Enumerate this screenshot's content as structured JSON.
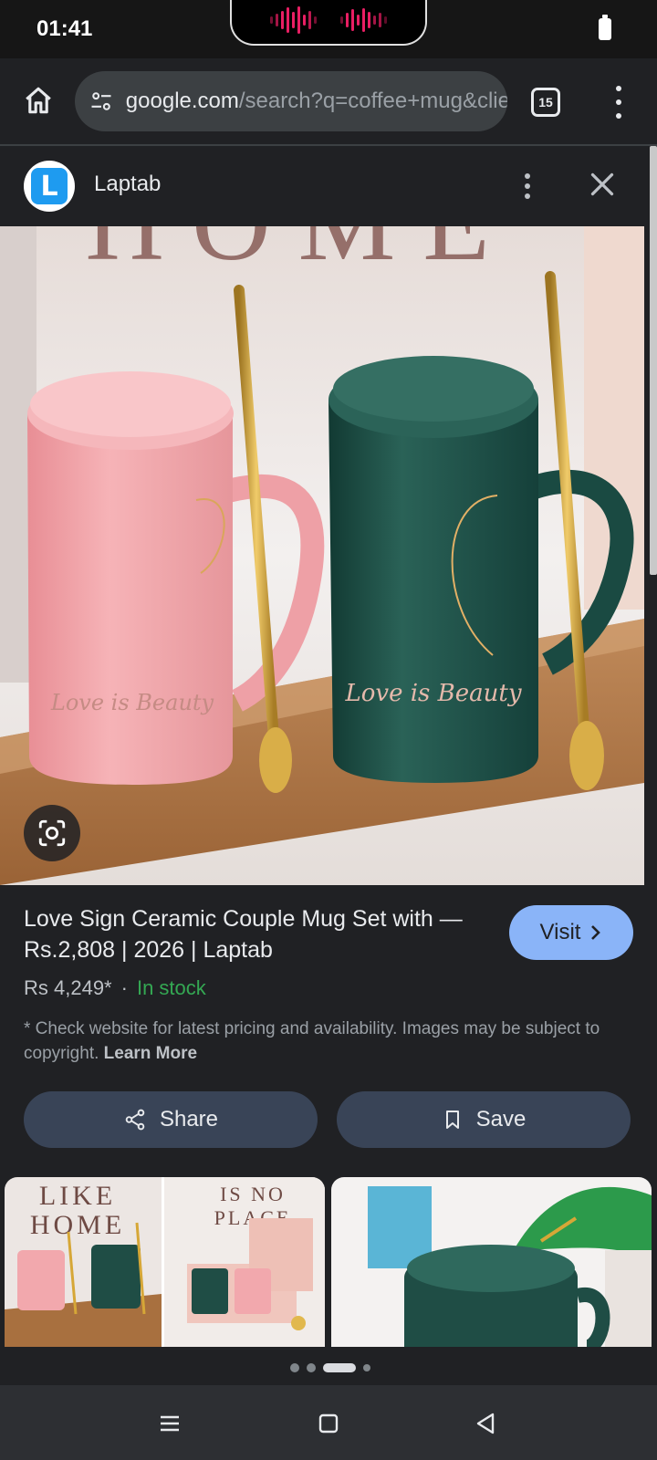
{
  "status_bar": {
    "time": "01:41"
  },
  "browser": {
    "url_host": "google.com",
    "url_path": "/search?q=coffee+mug&clie",
    "tab_count": "15"
  },
  "source": {
    "logo_letter": "L",
    "name": "Laptab"
  },
  "product": {
    "title": "Love Sign Ceramic Couple Mug Set with — Rs.2,808 | 2026 | Laptab",
    "price": "Rs 4,249*",
    "separator": "·",
    "stock": "In stock",
    "disclaimer": "* Check website for latest pricing and availability. Images may be subject to copyright.",
    "learn_more": "Learn More"
  },
  "image_text": {
    "wall_text": "HOME",
    "mug_text": "Love is Beauty",
    "thumb_wall_1": "LIKE",
    "thumb_wall_2": "HOME",
    "thumb_wall_3": "IS NO",
    "thumb_wall_4": "PLACE"
  },
  "actions": {
    "visit": "Visit",
    "share": "Share",
    "save": "Save"
  },
  "colors": {
    "accent": "#8ab4f8",
    "stock_green": "#34a853",
    "pink_mug": "#f2a3a8",
    "green_mug": "#1d4a42",
    "gold": "#d6a737"
  },
  "carousel": {
    "pages": 4,
    "active_index": 2
  },
  "icons": {
    "home": "home-icon",
    "site_settings": "tune-icon",
    "menu": "more-vert-icon",
    "close": "close-icon",
    "lens": "google-lens-icon",
    "share": "share-icon",
    "save": "bookmark-icon",
    "nav_recents": "recents-icon",
    "nav_home": "nav-home-icon",
    "nav_back": "back-icon"
  }
}
